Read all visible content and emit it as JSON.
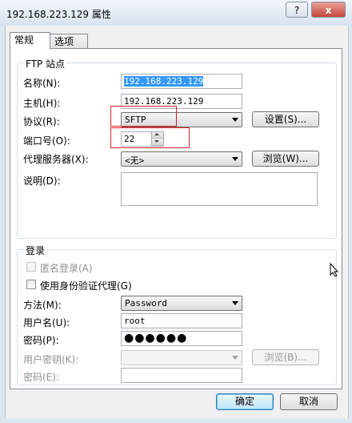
{
  "window": {
    "title": "192.168.223.129 属性",
    "help_label": "?",
    "close_label": "x"
  },
  "tabs": [
    {
      "label": "常规",
      "active": true
    },
    {
      "label": "选项",
      "active": false
    }
  ],
  "ftp_site": {
    "group_label": "FTP 站点",
    "name": {
      "label": "名称(N):",
      "value": "192.168.223.129"
    },
    "host": {
      "label": "主机(H):",
      "value": "192.168.223.129"
    },
    "protocol": {
      "label": "协议(R):",
      "value": "SFTP",
      "settings_label": "设置(S)..."
    },
    "port": {
      "label": "端口号(O):",
      "value": "22"
    },
    "proxy": {
      "label": "代理服务器(X):",
      "value": "<无>",
      "browse_label": "浏览(W)..."
    },
    "description": {
      "label": "说明(D):",
      "value": ""
    }
  },
  "login": {
    "group_label": "登录",
    "anonymous": {
      "label": "匿名登录(A)",
      "checked": false,
      "enabled": false
    },
    "auth_agent": {
      "label": "使用身份验证代理(G)",
      "checked": false,
      "enabled": true
    },
    "method": {
      "label": "方法(M):",
      "value": "Password"
    },
    "username": {
      "label": "用户名(U):",
      "value": "root"
    },
    "password": {
      "label": "密码(P):",
      "value": "●●●●●●"
    },
    "user_key": {
      "label": "用户密钥(K):",
      "value": "",
      "browse_label": "浏览(B)..."
    },
    "passphrase": {
      "label": "密码(E):",
      "value": ""
    }
  },
  "footer": {
    "ok_label": "确定",
    "cancel_label": "取消"
  },
  "colors": {
    "highlight_box": "#e02020",
    "selection": "#3399ff"
  }
}
